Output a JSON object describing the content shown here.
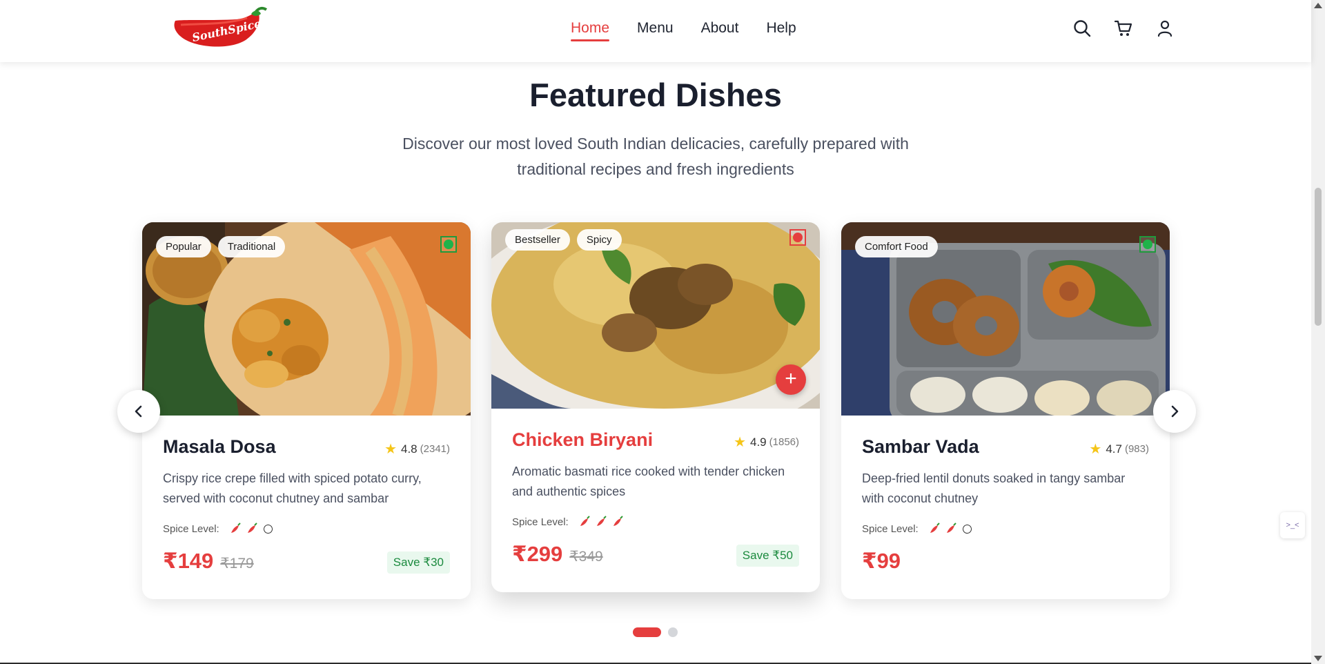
{
  "header": {
    "logo_text": "SouthSpice",
    "nav": [
      {
        "label": "Home",
        "active": true
      },
      {
        "label": "Menu",
        "active": false
      },
      {
        "label": "About",
        "active": false
      },
      {
        "label": "Help",
        "active": false
      }
    ],
    "icons": [
      "search-icon",
      "cart-icon",
      "user-icon"
    ]
  },
  "section": {
    "title": "Featured Dishes",
    "subtitle": "Discover our most loved South Indian delicacies, carefully prepared with traditional recipes and fresh ingredients"
  },
  "dishes": [
    {
      "name": "Masala Dosa",
      "tags": [
        "Popular",
        "Traditional"
      ],
      "diet": "veg",
      "rating": "4.8",
      "reviews": "(2341)",
      "description": "Crispy rice crepe filled with spiced potato curry, served with coconut chutney and sambar",
      "spice_label": "Spice Level:",
      "spice_level": 2,
      "spice_max": 3,
      "price": "₹149",
      "old_price": "₹179",
      "save": "Save ₹30"
    },
    {
      "name": "Chicken Biryani",
      "tags": [
        "Bestseller",
        "Spicy"
      ],
      "diet": "non-veg",
      "rating": "4.9",
      "reviews": "(1856)",
      "description": "Aromatic basmati rice cooked with tender chicken and authentic spices",
      "spice_label": "Spice Level:",
      "spice_level": 3,
      "spice_max": 3,
      "price": "₹299",
      "old_price": "₹349",
      "save": "Save ₹50"
    },
    {
      "name": "Sambar Vada",
      "tags": [
        "Comfort Food"
      ],
      "diet": "veg",
      "rating": "4.7",
      "reviews": "(983)",
      "description": "Deep-fried lentil donuts soaked in tangy sambar with coconut chutney",
      "spice_label": "Spice Level:",
      "spice_level": 2,
      "spice_max": 3,
      "price": "₹99",
      "old_price": "",
      "save": ""
    }
  ],
  "carousel": {
    "pages": 2,
    "active_page": 1,
    "prev_icon": "chevron-left-icon",
    "next_icon": "chevron-right-icon"
  },
  "extension_widget": ">_<",
  "colors": {
    "accent": "#e53e3e",
    "veg": "#1fb34a",
    "save_bg": "#e9f8ee",
    "save_text": "#1b8a3e"
  }
}
